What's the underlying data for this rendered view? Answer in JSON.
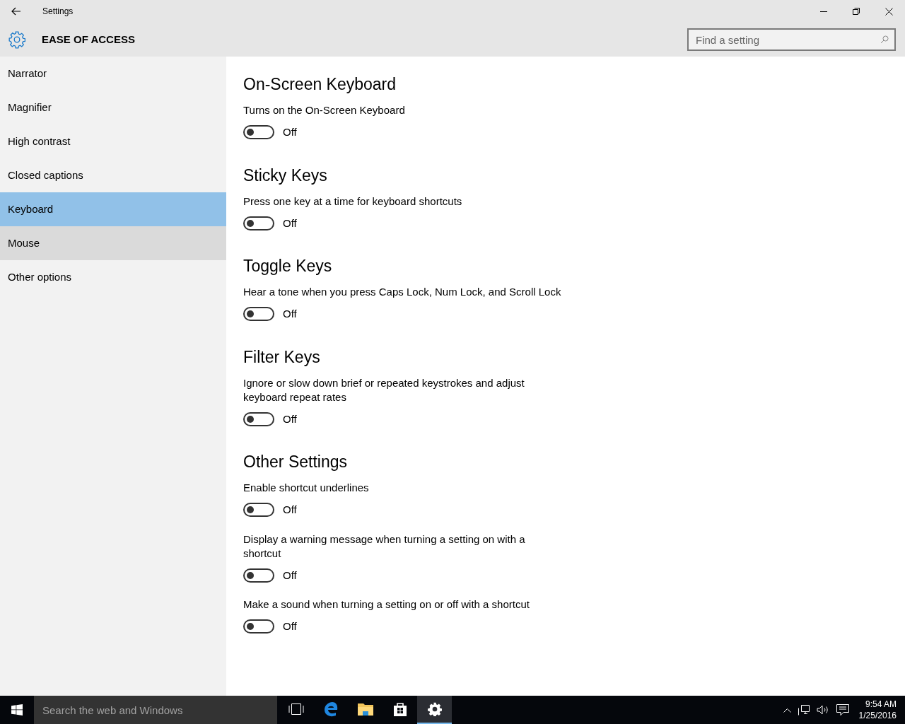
{
  "window": {
    "title": "Settings"
  },
  "header": {
    "title": "EASE OF ACCESS",
    "search": {
      "placeholder": "Find a setting"
    }
  },
  "sidebar": {
    "items": [
      {
        "label": "Narrator",
        "selected": false,
        "hovered": false
      },
      {
        "label": "Magnifier",
        "selected": false,
        "hovered": false
      },
      {
        "label": "High contrast",
        "selected": false,
        "hovered": false
      },
      {
        "label": "Closed captions",
        "selected": false,
        "hovered": false
      },
      {
        "label": "Keyboard",
        "selected": true,
        "hovered": false
      },
      {
        "label": "Mouse",
        "selected": false,
        "hovered": true
      },
      {
        "label": "Other options",
        "selected": false,
        "hovered": false
      }
    ]
  },
  "sections": [
    {
      "heading": "On-Screen Keyboard",
      "settings": [
        {
          "description": "Turns on the On-Screen Keyboard",
          "on": false,
          "state_label": "Off"
        }
      ]
    },
    {
      "heading": "Sticky Keys",
      "settings": [
        {
          "description": "Press one key at a time for keyboard shortcuts",
          "on": false,
          "state_label": "Off"
        }
      ]
    },
    {
      "heading": "Toggle Keys",
      "settings": [
        {
          "description": "Hear a tone when you press Caps Lock, Num Lock, and Scroll Lock",
          "on": false,
          "state_label": "Off"
        }
      ]
    },
    {
      "heading": "Filter Keys",
      "settings": [
        {
          "description": "Ignore or slow down brief or repeated keystrokes and adjust keyboard repeat rates",
          "on": false,
          "state_label": "Off"
        }
      ]
    },
    {
      "heading": "Other Settings",
      "settings": [
        {
          "description": "Enable shortcut underlines",
          "on": false,
          "state_label": "Off"
        },
        {
          "description": "Display a warning message when turning a setting on with a shortcut",
          "on": false,
          "state_label": "Off"
        },
        {
          "description": "Make a sound when turning a setting on or off with a shortcut",
          "on": false,
          "state_label": "Off"
        }
      ]
    }
  ],
  "taskbar": {
    "search": {
      "placeholder": "Search the web and Windows"
    },
    "apps": [
      {
        "kind": "taskview",
        "selected": false
      },
      {
        "kind": "edge",
        "selected": false
      },
      {
        "kind": "explorer",
        "selected": false
      },
      {
        "kind": "store",
        "selected": false
      },
      {
        "kind": "settings",
        "selected": true
      }
    ],
    "time": "9:54 AM",
    "date": "1/25/2016"
  }
}
